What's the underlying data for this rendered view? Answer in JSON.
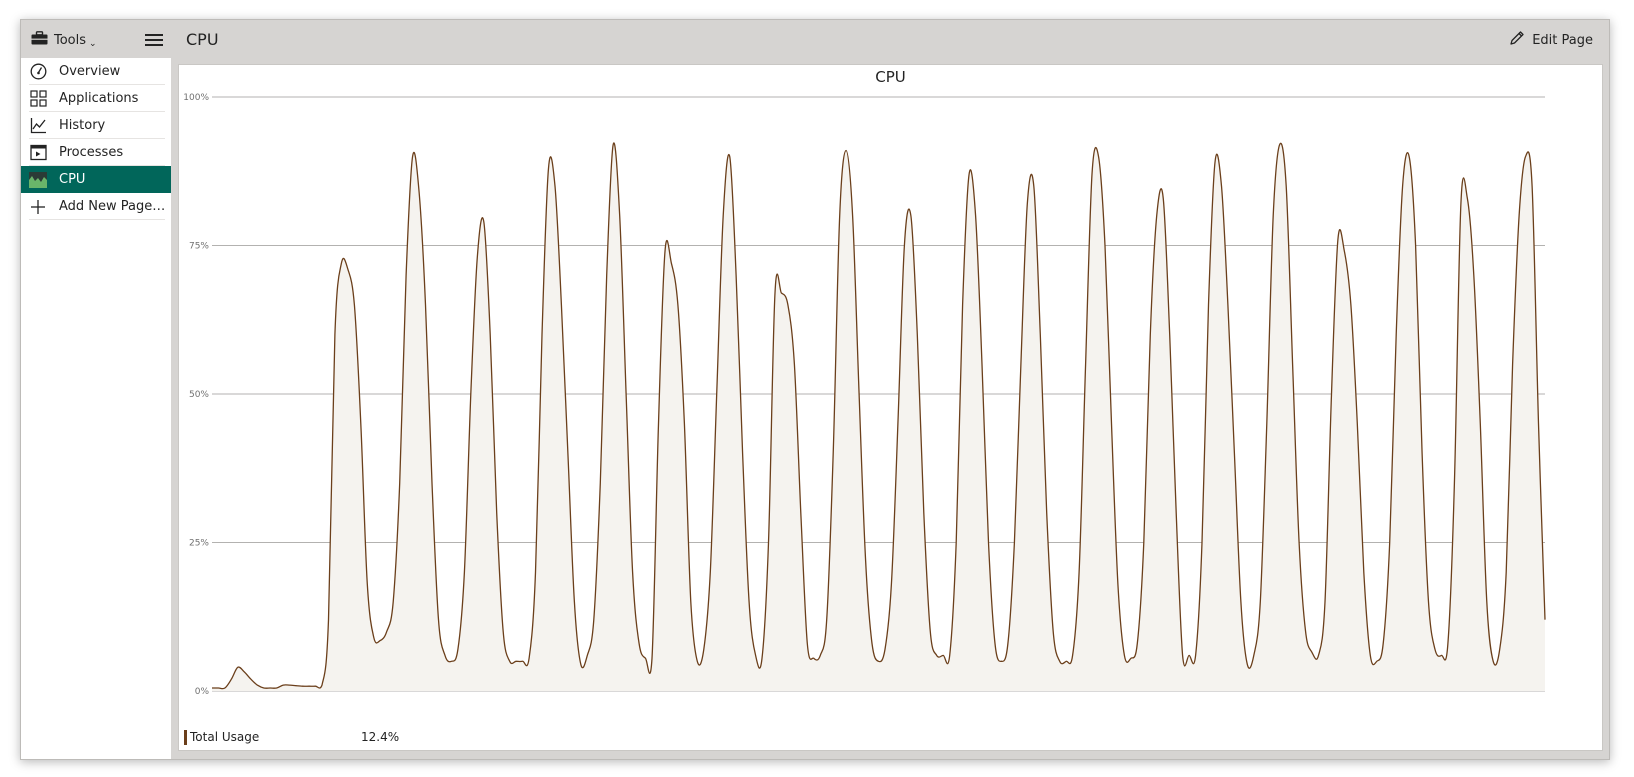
{
  "topbar": {
    "tools_label": "Tools",
    "title": "CPU",
    "edit_label": "Edit Page"
  },
  "sidebar": {
    "items": [
      {
        "label": "Overview",
        "icon": "speedometer-icon"
      },
      {
        "label": "Applications",
        "icon": "grid-icon"
      },
      {
        "label": "History",
        "icon": "line-chart-icon"
      },
      {
        "label": "Processes",
        "icon": "terminal-icon"
      },
      {
        "label": "CPU",
        "icon": "cpu-chart-icon",
        "active": true
      },
      {
        "label": "Add New Page…",
        "icon": "plus-icon"
      }
    ]
  },
  "colors": {
    "accent": "#01665a",
    "series_line": "#6b3f1b",
    "series_fill": "#f5f3ef",
    "grid": "#9a9896"
  },
  "chart_data": {
    "type": "area",
    "title": "CPU",
    "xlabel": "",
    "ylabel": "",
    "ylim": [
      0,
      100
    ],
    "y_ticks": [
      "0%",
      "25%",
      "50%",
      "75%",
      "100%"
    ],
    "grid": true,
    "legend": "bottom-left",
    "series": [
      {
        "name": "Total Usage",
        "values": [
          0.5,
          0.5,
          0.5,
          2,
          4,
          3.2,
          2,
          1,
          0.5,
          0.5,
          0.5,
          1,
          1,
          0.9,
          0.8,
          0.8,
          0.8,
          1,
          12,
          60,
          72,
          71,
          65,
          45,
          18,
          9,
          8.5,
          10,
          15,
          35,
          70,
          90,
          84,
          65,
          35,
          12,
          6,
          5,
          7,
          20,
          50,
          73,
          79,
          60,
          30,
          10,
          5,
          5,
          5,
          5.5,
          20,
          60,
          88,
          85,
          65,
          40,
          15,
          4.5,
          6,
          12,
          35,
          70,
          92,
          80,
          50,
          20,
          8,
          5.5,
          5.5,
          45,
          74,
          72,
          65,
          45,
          15,
          5,
          7,
          20,
          50,
          80,
          90,
          70,
          40,
          15,
          6,
          5.5,
          25,
          67,
          67,
          65,
          55,
          30,
          8,
          5.5,
          6,
          12,
          40,
          80,
          91,
          80,
          50,
          22,
          8,
          5,
          7,
          18,
          45,
          75,
          80,
          60,
          30,
          10,
          6,
          6,
          6,
          25,
          65,
          87,
          80,
          55,
          25,
          8,
          5,
          8,
          25,
          55,
          82,
          85,
          60,
          30,
          10,
          5,
          5,
          6,
          20,
          55,
          87,
          90,
          75,
          45,
          18,
          6,
          5.5,
          8,
          25,
          60,
          80,
          83,
          60,
          30,
          6,
          6,
          6,
          25,
          65,
          89,
          85,
          65,
          40,
          15,
          4.5,
          6,
          15,
          45,
          80,
          92,
          85,
          55,
          25,
          10,
          6.5,
          6,
          15,
          50,
          76,
          74,
          65,
          45,
          20,
          6,
          5,
          8,
          25,
          60,
          85,
          90,
          75,
          40,
          15,
          7,
          6,
          8,
          35,
          82,
          83,
          70,
          45,
          15,
          5,
          7,
          20,
          55,
          80,
          90,
          85,
          45,
          12
        ]
      }
    ]
  },
  "legend": {
    "label": "Total Usage",
    "value": "12.4%"
  }
}
